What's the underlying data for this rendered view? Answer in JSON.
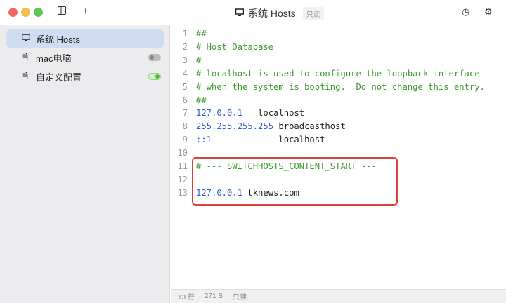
{
  "window": {
    "title": "系统 Hosts",
    "badge": "只读"
  },
  "sidebar": {
    "items": [
      {
        "label": "系统 Hosts",
        "icon": "monitor-icon",
        "selected": true
      },
      {
        "label": "mac电脑",
        "icon": "file-icon",
        "enabled": false
      },
      {
        "label": "自定义配置",
        "icon": "file-icon",
        "enabled": true
      }
    ]
  },
  "editor": {
    "lines": [
      {
        "n": "1",
        "parts": [
          [
            "c",
            "##"
          ]
        ]
      },
      {
        "n": "2",
        "parts": [
          [
            "c",
            "# Host Database"
          ]
        ]
      },
      {
        "n": "3",
        "parts": [
          [
            "c",
            "#"
          ]
        ]
      },
      {
        "n": "4",
        "parts": [
          [
            "c",
            "# localhost is used to configure the loopback interface"
          ]
        ]
      },
      {
        "n": "5",
        "parts": [
          [
            "c",
            "# when the system is booting.  Do not change this entry."
          ]
        ]
      },
      {
        "n": "6",
        "parts": [
          [
            "c",
            "##"
          ]
        ]
      },
      {
        "n": "7",
        "parts": [
          [
            "ip",
            "127.0.0.1"
          ],
          [
            "t",
            "   localhost"
          ]
        ]
      },
      {
        "n": "8",
        "parts": [
          [
            "ip",
            "255.255.255.255"
          ],
          [
            "t",
            " broadcasthost"
          ]
        ]
      },
      {
        "n": "9",
        "parts": [
          [
            "ip",
            "::1"
          ],
          [
            "t",
            "             localhost"
          ]
        ]
      },
      {
        "n": "10",
        "parts": []
      },
      {
        "n": "11",
        "parts": [
          [
            "c",
            "# --- SWITCHHOSTS_CONTENT_START ---"
          ]
        ]
      },
      {
        "n": "12",
        "parts": []
      },
      {
        "n": "13",
        "parts": [
          [
            "ip",
            "127.0.0.1"
          ],
          [
            "t",
            " tknews.com"
          ]
        ]
      }
    ]
  },
  "status": {
    "lines": "13 行",
    "size": "271 B",
    "mode": "只读"
  },
  "colors": {
    "highlight": "#d9433a",
    "comment": "#3a9b2c",
    "ip": "#2f5fd0"
  }
}
